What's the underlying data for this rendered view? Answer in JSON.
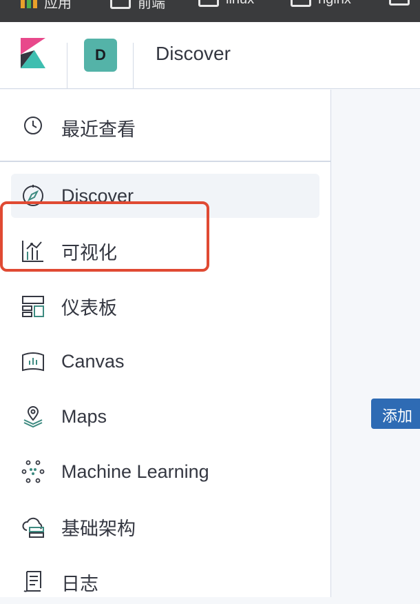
{
  "bookmarks": [
    {
      "label": "应用",
      "icon": "apps-icon"
    },
    {
      "label": "前端",
      "icon": "folder-icon"
    },
    {
      "label": "linux",
      "icon": "folder-icon"
    },
    {
      "label": "nginx",
      "icon": "folder-icon"
    }
  ],
  "header": {
    "space_initial": "D",
    "title": "Discover"
  },
  "sidenav": {
    "recent_label": "最近查看",
    "items": [
      {
        "label": "Discover",
        "icon": "compass-icon",
        "active": true
      },
      {
        "label": "可视化",
        "icon": "visualize-icon"
      },
      {
        "label": "仪表板",
        "icon": "dashboard-icon"
      },
      {
        "label": "Canvas",
        "icon": "canvas-icon"
      },
      {
        "label": "Maps",
        "icon": "maps-icon"
      },
      {
        "label": "Machine Learning",
        "icon": "machine-learning-icon"
      },
      {
        "label": "基础架构",
        "icon": "infrastructure-icon"
      },
      {
        "label": "日志",
        "icon": "logs-icon"
      }
    ]
  },
  "main": {
    "add_button_label": "添加"
  },
  "colors": {
    "accent_teal": "#54b3a8",
    "button_blue": "#2e6bb4",
    "highlight_red": "#e04a33",
    "icon_teal": "#3d8a80"
  }
}
